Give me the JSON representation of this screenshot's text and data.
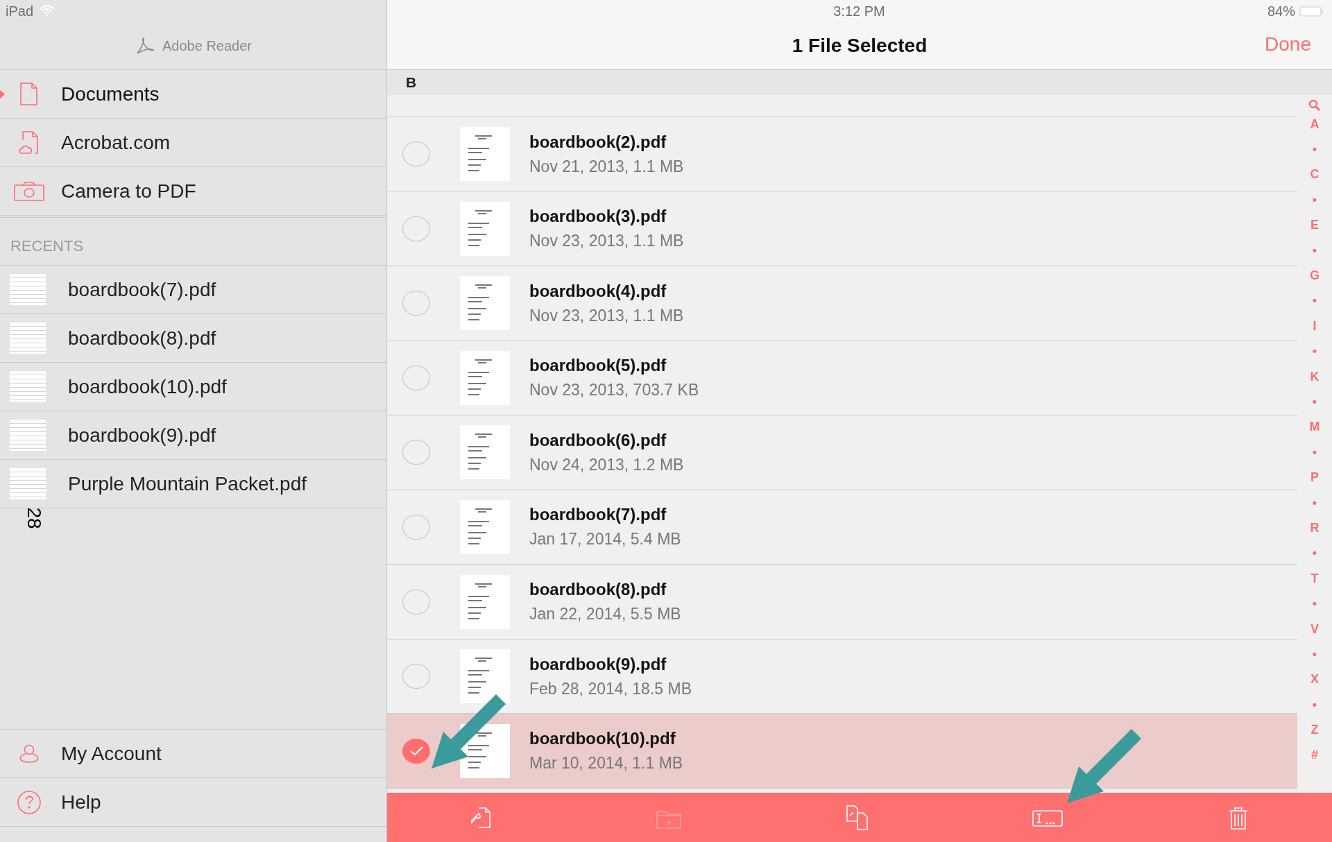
{
  "status_bar": {
    "device": "iPad",
    "time": "3:12 PM",
    "battery": "84%"
  },
  "sidebar": {
    "app_title": "Adobe Reader",
    "nav": [
      {
        "kind": "documents",
        "label": "Documents",
        "selected": true
      },
      {
        "kind": "cloud",
        "label": "Acrobat.com",
        "selected": false
      },
      {
        "kind": "camera",
        "label": "Camera to PDF",
        "selected": false
      }
    ],
    "recents_heading": "RECENTS",
    "recents": [
      "boardbook(7).pdf",
      "boardbook(8).pdf",
      "boardbook(10).pdf",
      "boardbook(9).pdf",
      "Purple Mountain Packet.pdf"
    ],
    "overlay_number": "28",
    "footer": [
      {
        "kind": "account",
        "label": "My Account"
      },
      {
        "kind": "help",
        "label": "Help"
      }
    ]
  },
  "header": {
    "title": "1 File Selected",
    "done": "Done"
  },
  "section": "B",
  "files": [
    {
      "name": "boardbook(2).pdf",
      "meta": "Nov 21, 2013, 1.1 MB",
      "selected": false
    },
    {
      "name": "boardbook(3).pdf",
      "meta": "Nov 23, 2013, 1.1 MB",
      "selected": false
    },
    {
      "name": "boardbook(4).pdf",
      "meta": "Nov 23, 2013, 1.1 MB",
      "selected": false
    },
    {
      "name": "boardbook(5).pdf",
      "meta": "Nov 23, 2013, 703.7 KB",
      "selected": false
    },
    {
      "name": "boardbook(6).pdf",
      "meta": "Nov 24, 2013, 1.2 MB",
      "selected": false
    },
    {
      "name": "boardbook(7).pdf",
      "meta": "Jan 17, 2014, 5.4 MB",
      "selected": false
    },
    {
      "name": "boardbook(8).pdf",
      "meta": "Jan 22, 2014, 5.5 MB",
      "selected": false
    },
    {
      "name": "boardbook(9).pdf",
      "meta": "Feb 28, 2014, 18.5 MB",
      "selected": false
    },
    {
      "name": "boardbook(10).pdf",
      "meta": "Mar 10, 2014, 1.1 MB",
      "selected": true
    }
  ],
  "index": [
    "A",
    "•",
    "C",
    "•",
    "E",
    "•",
    "G",
    "•",
    "I",
    "•",
    "K",
    "•",
    "M",
    "•",
    "P",
    "•",
    "R",
    "•",
    "T",
    "•",
    "V",
    "•",
    "X",
    "•",
    "Z",
    "#"
  ],
  "toolbar": [
    {
      "kind": "share",
      "disabled": false
    },
    {
      "kind": "folder",
      "disabled": true
    },
    {
      "kind": "copy",
      "disabled": false
    },
    {
      "kind": "rename",
      "disabled": false
    },
    {
      "kind": "trash",
      "disabled": false
    }
  ]
}
